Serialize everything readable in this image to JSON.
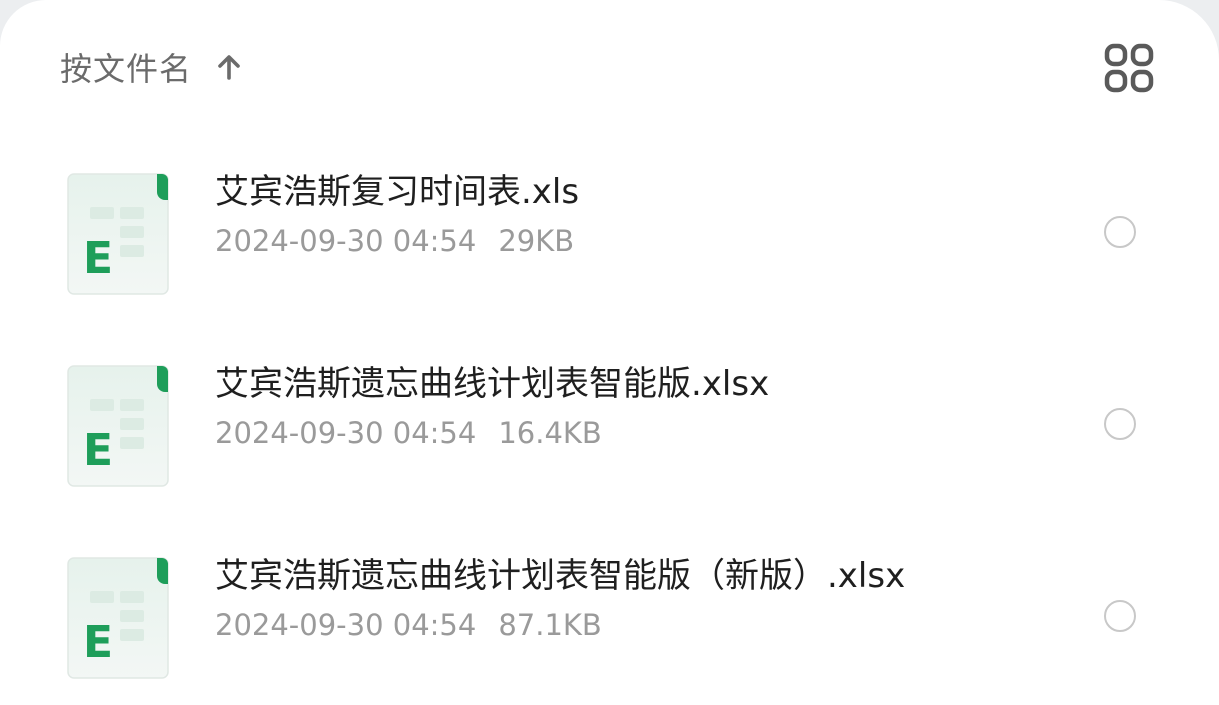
{
  "header": {
    "sort_label": "按文件名",
    "sort_direction_icon": "arrow-up-icon",
    "view_toggle_icon": "grid-view-icon"
  },
  "colors": {
    "icon_green": "#1e9e5a",
    "icon_bg": "#eef5f1",
    "text_primary": "#1f1f1f",
    "text_secondary": "#9a9a9a",
    "radio_border": "#c8c8c8"
  },
  "files": [
    {
      "name": "艾宾浩斯复习时间表.xls",
      "date": "2024-09-30 04:54",
      "size": "29KB",
      "icon": "excel-file-icon",
      "icon_letter": "E"
    },
    {
      "name": "艾宾浩斯遗忘曲线计划表智能版.xlsx",
      "date": "2024-09-30 04:54",
      "size": "16.4KB",
      "icon": "excel-file-icon",
      "icon_letter": "E"
    },
    {
      "name": "艾宾浩斯遗忘曲线计划表智能版（新版）.xlsx",
      "date": "2024-09-30 04:54",
      "size": "87.1KB",
      "icon": "excel-file-icon",
      "icon_letter": "E"
    }
  ]
}
